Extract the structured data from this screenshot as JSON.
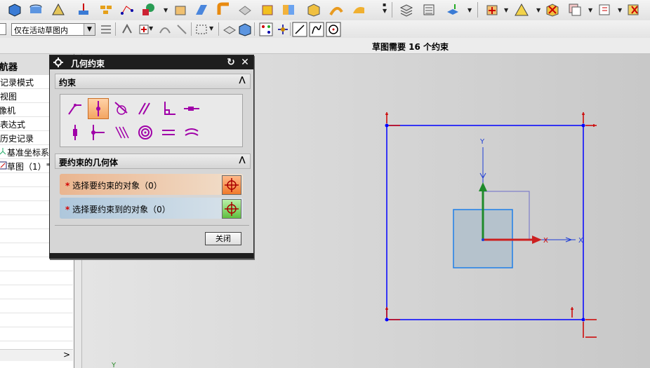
{
  "toolbar": {
    "snap_filter": {
      "value": "仅在活动草图内"
    }
  },
  "status": {
    "message": "草图需要  16  个约束"
  },
  "navigator": {
    "title": "导航器",
    "items": [
      {
        "label": "记录模式"
      },
      {
        "label": "视图"
      },
      {
        "label": "像机"
      },
      {
        "label": "表达式"
      },
      {
        "label": "历史记录"
      },
      {
        "label": "基准坐标系"
      },
      {
        "label": "草图（1）\""
      }
    ],
    "scroll_arrow": ">"
  },
  "dialog": {
    "title": "几何约束",
    "constraints_section": {
      "title": "约束"
    },
    "geometry_section": {
      "title": "要约束的几何体",
      "select_object": {
        "label": "选择要约束的对象（0）"
      },
      "select_target": {
        "label": "选择要约束到的对象（0）"
      }
    },
    "close_label": "关闭"
  },
  "canvas": {
    "axis_labels": {
      "x1": "X",
      "x2": "X",
      "y": "Y",
      "y_bottom": "Y"
    }
  },
  "colors": {
    "sketch_line": "#0000ff",
    "dimension_marker": "#cc0000",
    "select_object_bg": "#eab58f",
    "select_target_bg": "#aec7dc",
    "active_constraint": "#f3a561",
    "constraint_icon": "#a000a8"
  }
}
